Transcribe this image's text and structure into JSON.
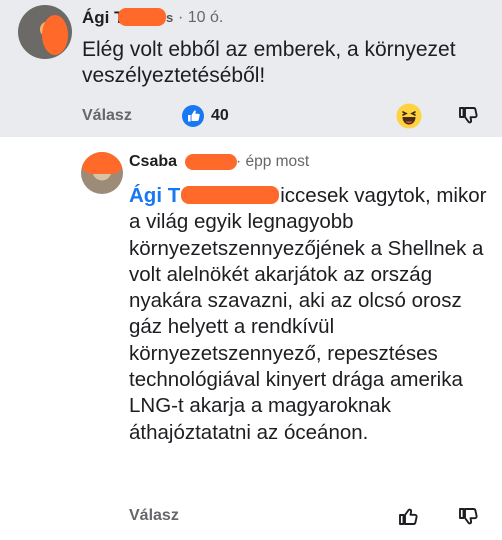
{
  "comment1": {
    "author_visible": "Ági T",
    "author_suffix": "s",
    "time": "10 ó.",
    "text": "Elég volt ebből az emberek, a környezet veszélyeztetéséből!",
    "reply_label": "Válasz",
    "like_count": "40"
  },
  "comment2": {
    "author_visible": "Csaba",
    "time": "épp most",
    "mention": "Ági T",
    "text_first": "iccesek vagytok,",
    "text_rest": "mikor a világ egyik legnagyobb környezetszennyezőjének a Shellnek a volt alelnökét akarjátok az ország nyakára szavazni, aki az olcsó orosz gáz helyett a rendkívül környezetszennyező, repesztéses technológiával kinyert drága amerika LNG-t akarja a magyaroknak áthajóztatatni az óceánon.",
    "reply_label": "Válasz"
  },
  "colors": {
    "top_bg": "#e9ebee",
    "mention": "#1877f2",
    "redaction": "#ff6a2a",
    "like_blue": "#1877f2"
  },
  "icons": [
    "like-reaction-icon",
    "haha-reaction-icon",
    "dislike-icon",
    "thumbs-up-icon"
  ]
}
